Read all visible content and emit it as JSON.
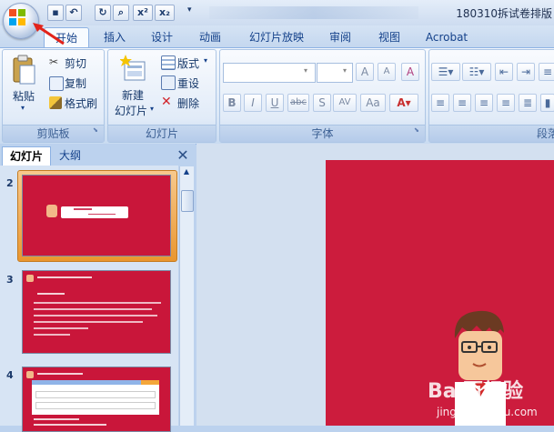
{
  "window": {
    "title": "180310拆试卷排版"
  },
  "quick_access": {
    "redo_label": "x²",
    "sub_label": "x₂"
  },
  "tabs": [
    "开始",
    "插入",
    "设计",
    "动画",
    "幻灯片放映",
    "审阅",
    "视图",
    "Acrobat"
  ],
  "ribbon": {
    "clipboard": {
      "paste": "粘贴",
      "cut": "剪切",
      "copy": "复制",
      "format_painter": "格式刷",
      "label": "剪贴板"
    },
    "slides": {
      "new_slide_line1": "新建",
      "new_slide_line2": "幻灯片",
      "layout": "版式",
      "reset": "重设",
      "delete": "删除",
      "label": "幻灯片"
    },
    "font": {
      "label": "字体",
      "bold": "B",
      "italic": "I",
      "underline": "U",
      "strike": "abc",
      "shadow": "S",
      "spacing": "AV",
      "case": "Aa",
      "grow": "A",
      "shrink": "A",
      "clear": "A"
    },
    "paragraph": {
      "label": "段落"
    }
  },
  "pane": {
    "tab_slides": "幻灯片",
    "tab_outline": "大纲"
  },
  "thumbnails": [
    {
      "number": "2"
    },
    {
      "number": "3"
    },
    {
      "number": "4"
    }
  ],
  "watermark": {
    "brand": "Bai百经验",
    "url": "jingyan.baidu.com"
  },
  "colors": {
    "slide_red": "#cc1c3d",
    "accent_blue": "#15428b"
  }
}
